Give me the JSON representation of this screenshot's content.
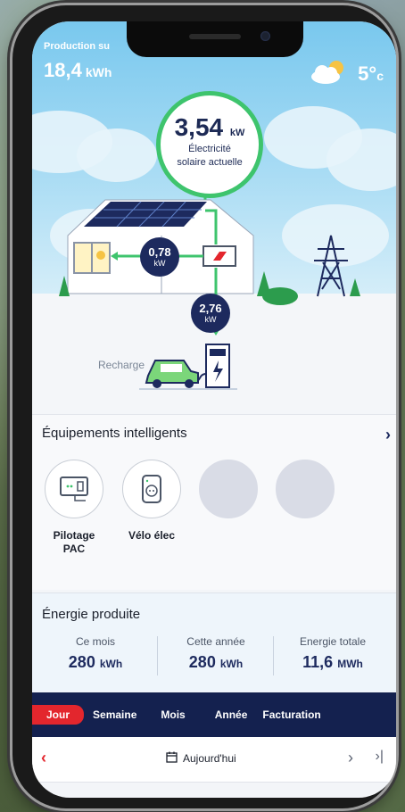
{
  "header": {
    "production_label": "Production su",
    "production_value": "18,4",
    "production_unit": "kWh",
    "weather_icon": "partly-cloudy-icon",
    "temperature": "5°",
    "temperature_unit": "c"
  },
  "solar": {
    "value": "3,54",
    "unit": "kW",
    "label_line1": "Électricité",
    "label_line2": "solaire actuelle"
  },
  "flows": {
    "house": {
      "value": "0,78",
      "unit": "kW"
    },
    "charger": {
      "value": "2,76",
      "unit": "kW"
    },
    "recharge_label": "Recharge"
  },
  "devices": {
    "title": "Équipements intelligents",
    "items": [
      {
        "name_line1": "Pilotage",
        "name_line2": "PAC",
        "icon": "heat-pump-controller-icon"
      },
      {
        "name_line1": "Vélo élec",
        "name_line2": "",
        "icon": "smart-plug-icon"
      }
    ]
  },
  "produced": {
    "title": "Énergie produite",
    "stats": [
      {
        "label": "Ce mois",
        "value": "280",
        "unit": "kWh"
      },
      {
        "label": "Cette année",
        "value": "280",
        "unit": "kWh"
      },
      {
        "label": "Energie totale",
        "value": "11,6",
        "unit": "MWh"
      }
    ]
  },
  "tabs": [
    "Jour",
    "Semaine",
    "Mois",
    "Année",
    "Facturation"
  ],
  "active_tab": "Jour",
  "datebar": {
    "label": "Aujourd'hui",
    "icon": "calendar-icon"
  },
  "colors": {
    "navy": "#1d2a5e",
    "green": "#3ec46d",
    "red": "#e3262d",
    "sky": "#79c8ee"
  }
}
